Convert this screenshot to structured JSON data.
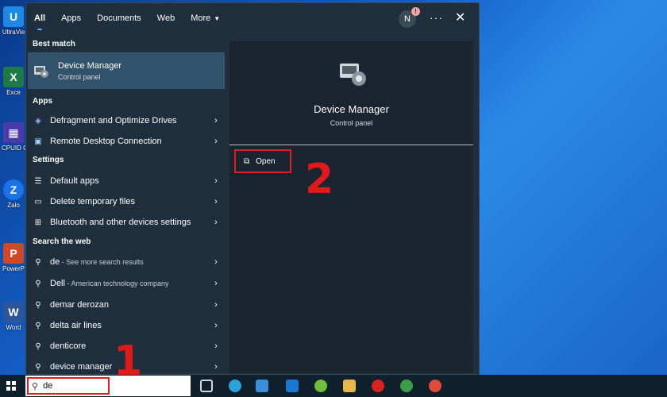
{
  "desktop": {
    "icons": [
      {
        "label": "UltraVie",
        "color": "#1e88e5"
      },
      {
        "label": "Exce",
        "color": "#1d7a45"
      },
      {
        "label": "CPUID C",
        "color": "#4a3ca8"
      },
      {
        "label": "Zalo",
        "color": "#1a73e8"
      },
      {
        "label": "PowerP",
        "color": "#d24726"
      },
      {
        "label": "Word",
        "color": "#2b579a"
      }
    ]
  },
  "search_panel": {
    "tabs": [
      {
        "label": "All",
        "active": true
      },
      {
        "label": "Apps"
      },
      {
        "label": "Documents"
      },
      {
        "label": "Web"
      },
      {
        "label": "More"
      }
    ],
    "avatar": "N",
    "badge": "!",
    "more_options": "···",
    "close": "✕",
    "best_match_heading": "Best match",
    "best_match": {
      "title": "Device Manager",
      "subtitle": "Control panel"
    },
    "apps_heading": "Apps",
    "apps": [
      {
        "label": "Defragment and Optimize Drives"
      },
      {
        "label": "Remote Desktop Connection"
      }
    ],
    "settings_heading": "Settings",
    "settings": [
      {
        "label": "Default apps"
      },
      {
        "label": "Delete temporary files"
      },
      {
        "label": "Bluetooth and other devices settings"
      }
    ],
    "web_heading": "Search the web",
    "web": [
      {
        "label": "de",
        "sub": " - See more search results"
      },
      {
        "label": "Dell",
        "sub": " - American technology company"
      },
      {
        "label": "demar derozan",
        "sub": ""
      },
      {
        "label": "delta air lines",
        "sub": ""
      },
      {
        "label": "denticore",
        "sub": ""
      },
      {
        "label": "device manager",
        "sub": ""
      }
    ],
    "detail": {
      "title": "Device Manager",
      "subtitle": "Control panel",
      "open_label": "Open"
    }
  },
  "annotations": {
    "step1": "1",
    "step2": "2"
  },
  "taskbar": {
    "search_value": "de"
  },
  "colors": {
    "accent": "#5ab0ff",
    "highlight": "#e02020"
  }
}
